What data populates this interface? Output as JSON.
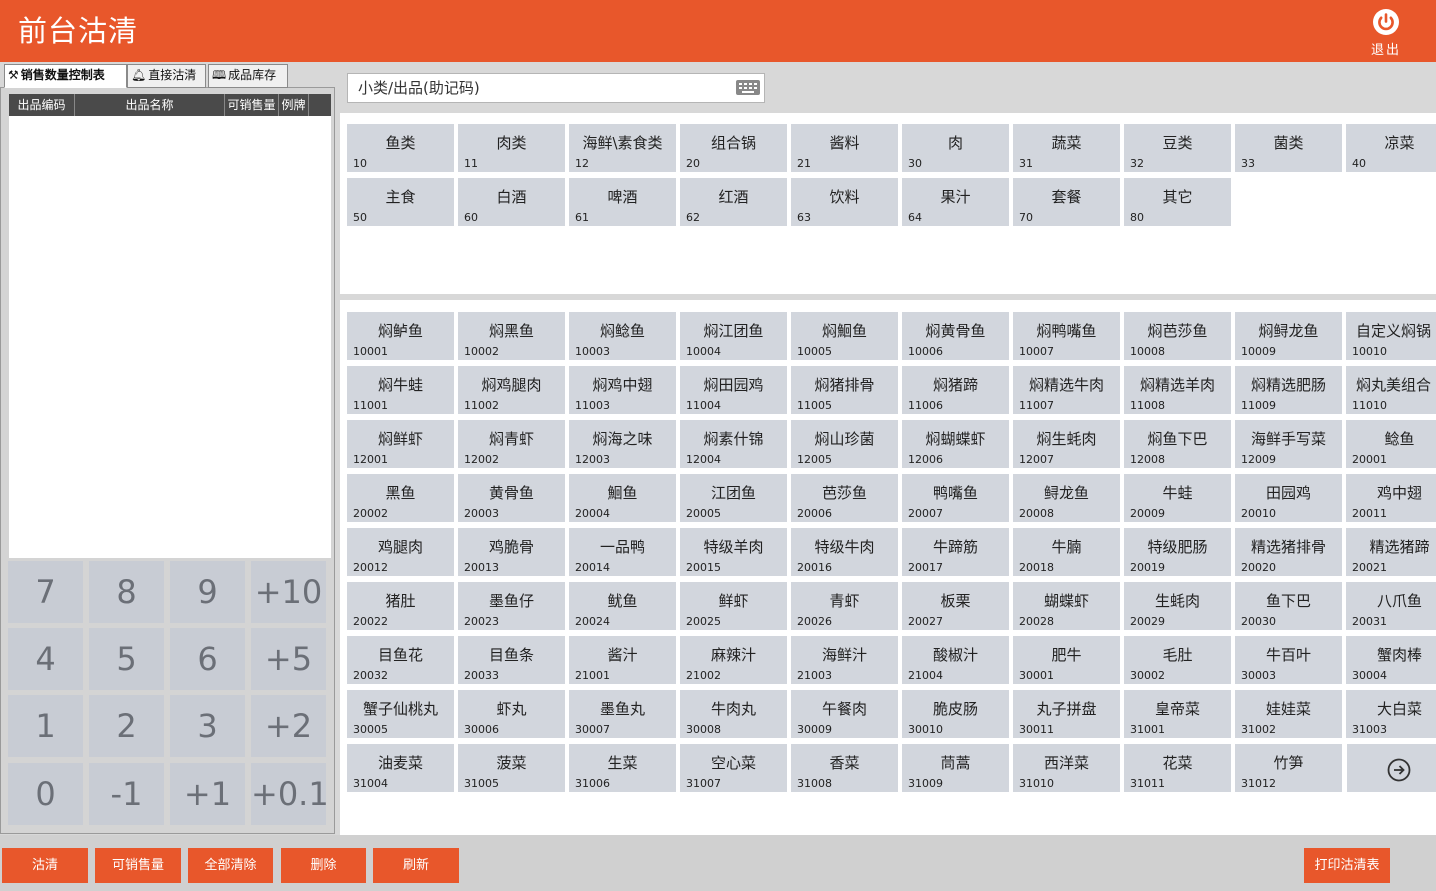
{
  "header": {
    "title": "前台沽清",
    "exit_label": "退出"
  },
  "tabs": [
    {
      "label": "销售数量控制表",
      "icon": "wrench-icon"
    },
    {
      "label": "直接沽清",
      "icon": "bell-icon"
    },
    {
      "label": "成品库存",
      "icon": "book-icon"
    }
  ],
  "list": {
    "columns": [
      "出品编码",
      "出品名称",
      "可销售量",
      "例牌"
    ]
  },
  "numpad": [
    "7",
    "8",
    "9",
    "+10",
    "4",
    "5",
    "6",
    "+5",
    "1",
    "2",
    "3",
    "+2",
    "0",
    "-1",
    "+1",
    "+0.1"
  ],
  "search": {
    "placeholder": "小类/出品(助记码)",
    "icon": "keyboard-icon"
  },
  "categories": [
    {
      "name": "鱼类",
      "code": "10"
    },
    {
      "name": "肉类",
      "code": "11"
    },
    {
      "name": "海鲜\\素食类",
      "code": "12"
    },
    {
      "name": "组合锅",
      "code": "20"
    },
    {
      "name": "酱料",
      "code": "21"
    },
    {
      "name": "肉",
      "code": "30"
    },
    {
      "name": "蔬菜",
      "code": "31"
    },
    {
      "name": "豆类",
      "code": "32"
    },
    {
      "name": "菌类",
      "code": "33"
    },
    {
      "name": "凉菜",
      "code": "40"
    },
    {
      "name": "主食",
      "code": "50"
    },
    {
      "name": "白酒",
      "code": "60"
    },
    {
      "name": "啤酒",
      "code": "61"
    },
    {
      "name": "红酒",
      "code": "62"
    },
    {
      "name": "饮料",
      "code": "63"
    },
    {
      "name": "果汁",
      "code": "64"
    },
    {
      "name": "套餐",
      "code": "70"
    },
    {
      "name": "其它",
      "code": "80"
    }
  ],
  "items": [
    {
      "name": "焖鲈鱼",
      "code": "10001"
    },
    {
      "name": "焖黑鱼",
      "code": "10002"
    },
    {
      "name": "焖鲶鱼",
      "code": "10003"
    },
    {
      "name": "焖江团鱼",
      "code": "10004"
    },
    {
      "name": "焖鮰鱼",
      "code": "10005"
    },
    {
      "name": "焖黄骨鱼",
      "code": "10006"
    },
    {
      "name": "焖鸭嘴鱼",
      "code": "10007"
    },
    {
      "name": "焖芭莎鱼",
      "code": "10008"
    },
    {
      "name": "焖鲟龙鱼",
      "code": "10009"
    },
    {
      "name": "自定义焖锅",
      "code": "10010"
    },
    {
      "name": "焖牛蛙",
      "code": "11001"
    },
    {
      "name": "焖鸡腿肉",
      "code": "11002"
    },
    {
      "name": "焖鸡中翅",
      "code": "11003"
    },
    {
      "name": "焖田园鸡",
      "code": "11004"
    },
    {
      "name": "焖猪排骨",
      "code": "11005"
    },
    {
      "name": "焖猪蹄",
      "code": "11006"
    },
    {
      "name": "焖精选牛肉",
      "code": "11007"
    },
    {
      "name": "焖精选羊肉",
      "code": "11008"
    },
    {
      "name": "焖精选肥肠",
      "code": "11009"
    },
    {
      "name": "焖丸美组合",
      "code": "11010"
    },
    {
      "name": "焖鲜虾",
      "code": "12001"
    },
    {
      "name": "焖青虾",
      "code": "12002"
    },
    {
      "name": "焖海之味",
      "code": "12003"
    },
    {
      "name": "焖素什锦",
      "code": "12004"
    },
    {
      "name": "焖山珍菌",
      "code": "12005"
    },
    {
      "name": "焖蝴蝶虾",
      "code": "12006"
    },
    {
      "name": "焖生蚝肉",
      "code": "12007"
    },
    {
      "name": "焖鱼下巴",
      "code": "12008"
    },
    {
      "name": "海鲜手写菜",
      "code": "12009"
    },
    {
      "name": "鲶鱼",
      "code": "20001"
    },
    {
      "name": "黑鱼",
      "code": "20002"
    },
    {
      "name": "黄骨鱼",
      "code": "20003"
    },
    {
      "name": "鮰鱼",
      "code": "20004"
    },
    {
      "name": "江团鱼",
      "code": "20005"
    },
    {
      "name": "芭莎鱼",
      "code": "20006"
    },
    {
      "name": "鸭嘴鱼",
      "code": "20007"
    },
    {
      "name": "鲟龙鱼",
      "code": "20008"
    },
    {
      "name": "牛蛙",
      "code": "20009"
    },
    {
      "name": "田园鸡",
      "code": "20010"
    },
    {
      "name": "鸡中翅",
      "code": "20011"
    },
    {
      "name": "鸡腿肉",
      "code": "20012"
    },
    {
      "name": "鸡脆骨",
      "code": "20013"
    },
    {
      "name": "一品鸭",
      "code": "20014"
    },
    {
      "name": "特级羊肉",
      "code": "20015"
    },
    {
      "name": "特级牛肉",
      "code": "20016"
    },
    {
      "name": "牛蹄筋",
      "code": "20017"
    },
    {
      "name": "牛腩",
      "code": "20018"
    },
    {
      "name": "特级肥肠",
      "code": "20019"
    },
    {
      "name": "精选猪排骨",
      "code": "20020"
    },
    {
      "name": "精选猪蹄",
      "code": "20021"
    },
    {
      "name": "猪肚",
      "code": "20022"
    },
    {
      "name": "墨鱼仔",
      "code": "20023"
    },
    {
      "name": "鱿鱼",
      "code": "20024"
    },
    {
      "name": "鲜虾",
      "code": "20025"
    },
    {
      "name": "青虾",
      "code": "20026"
    },
    {
      "name": "板栗",
      "code": "20027"
    },
    {
      "name": "蝴蝶虾",
      "code": "20028"
    },
    {
      "name": "生蚝肉",
      "code": "20029"
    },
    {
      "name": "鱼下巴",
      "code": "20030"
    },
    {
      "name": "八爪鱼",
      "code": "20031"
    },
    {
      "name": "目鱼花",
      "code": "20032"
    },
    {
      "name": "目鱼条",
      "code": "20033"
    },
    {
      "name": "酱汁",
      "code": "21001"
    },
    {
      "name": "麻辣汁",
      "code": "21002"
    },
    {
      "name": "海鲜汁",
      "code": "21003"
    },
    {
      "name": "酸椒汁",
      "code": "21004"
    },
    {
      "name": "肥牛",
      "code": "30001"
    },
    {
      "name": "毛肚",
      "code": "30002"
    },
    {
      "name": "牛百叶",
      "code": "30003"
    },
    {
      "name": "蟹肉棒",
      "code": "30004"
    },
    {
      "name": "蟹子仙桃丸",
      "code": "30005"
    },
    {
      "name": "虾丸",
      "code": "30006"
    },
    {
      "name": "墨鱼丸",
      "code": "30007"
    },
    {
      "name": "牛肉丸",
      "code": "30008"
    },
    {
      "name": "午餐肉",
      "code": "30009"
    },
    {
      "name": "脆皮肠",
      "code": "30010"
    },
    {
      "name": "丸子拼盘",
      "code": "30011"
    },
    {
      "name": "皇帝菜",
      "code": "31001"
    },
    {
      "name": "娃娃菜",
      "code": "31002"
    },
    {
      "name": "大白菜",
      "code": "31003"
    },
    {
      "name": "油麦菜",
      "code": "31004"
    },
    {
      "name": "菠菜",
      "code": "31005"
    },
    {
      "name": "生菜",
      "code": "31006"
    },
    {
      "name": "空心菜",
      "code": "31007"
    },
    {
      "name": "香菜",
      "code": "31008"
    },
    {
      "name": "茼蒿",
      "code": "31009"
    },
    {
      "name": "西洋菜",
      "code": "31010"
    },
    {
      "name": "花菜",
      "code": "31011"
    },
    {
      "name": "竹笋",
      "code": "31012"
    }
  ],
  "next_page_icon": "arrow-right-circle-icon",
  "actions_left": [
    "沽清",
    "可销售量",
    "全部清除",
    "删除",
    "刷新"
  ],
  "action_print": "打印沽清表",
  "colors": {
    "accent": "#e8572b",
    "tile": "#d2d6dd",
    "numpad": "#c8ccd4"
  }
}
